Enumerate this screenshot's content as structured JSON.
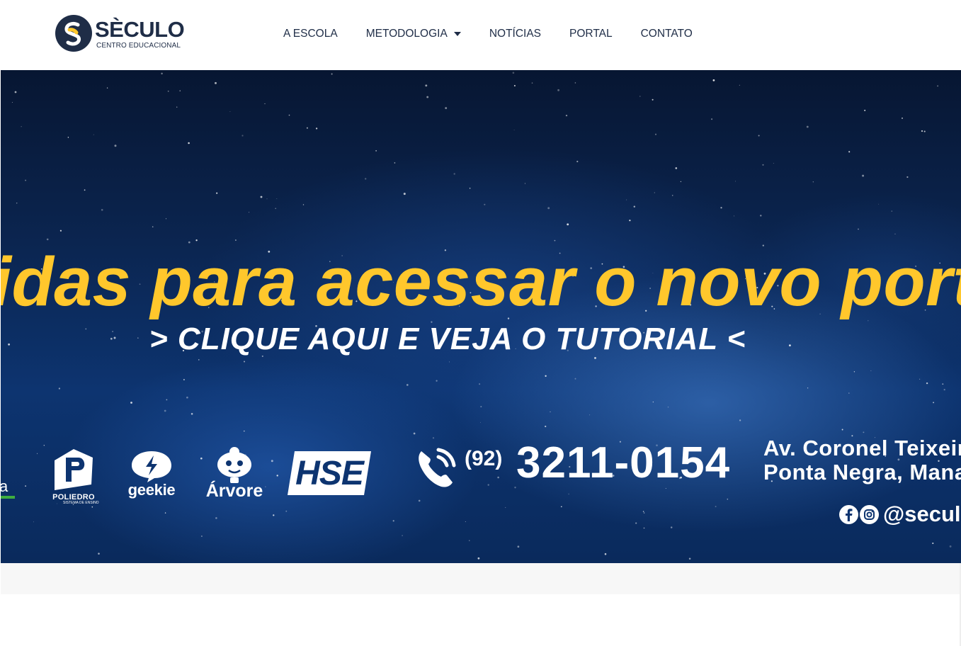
{
  "brand": {
    "name": "SÈCULO",
    "tagline": "CENTRO EDUCACIONAL",
    "colors": {
      "navy": "#1f2d47",
      "yellow": "#ffc72c"
    }
  },
  "nav": {
    "items": [
      {
        "label": "A ESCOLA",
        "has_dropdown": false
      },
      {
        "label": "METODOLOGIA",
        "has_dropdown": true
      },
      {
        "label": "NOTÍCIAS",
        "has_dropdown": false
      },
      {
        "label": "PORTAL",
        "has_dropdown": false
      },
      {
        "label": "CONTATO",
        "has_dropdown": false
      }
    ]
  },
  "hero": {
    "headline": "idas para acessar o novo portal",
    "tutorial_link": "> CLIQUE AQUI E VEJA O TUTORIAL <",
    "partners": {
      "cut_text": "a",
      "poliedro": "POLIEDRO",
      "poliedro_sub": "SISTEMA DE ENSINO",
      "geekie": "geekie",
      "arvore": "Árvore",
      "hse": "HSE"
    },
    "contact": {
      "ddd": "(92)",
      "phone": "3211-0154",
      "address_line1": "Av. Coronel Teixeira",
      "address_line2": "Ponta Negra, Manaus",
      "social_handle": "@seculo"
    },
    "icons": [
      "phone-icon",
      "facebook-icon",
      "instagram-icon"
    ]
  }
}
